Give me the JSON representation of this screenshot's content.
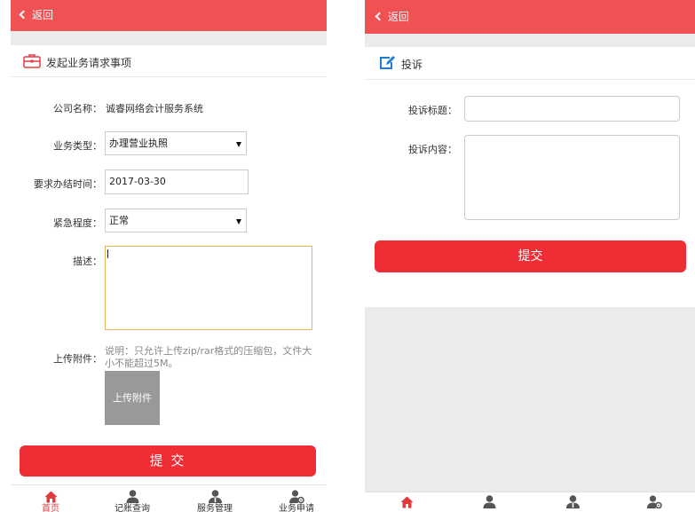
{
  "colors": {
    "brand": "#f05153",
    "submit": "#ee2e34",
    "active_tab": "#e03a3c",
    "focus_border": "#e6b75a",
    "edit_icon": "#1e7bd6"
  },
  "left": {
    "back_label": "返回",
    "section_title": "发起业务请求事项",
    "fields": {
      "company_label": "公司名称：",
      "company_value": "诚睿网络会计服务系统",
      "type_label": "业务类型：",
      "type_value": "办理营业执照",
      "deadline_label": "要求办结时间：",
      "deadline_value": "2017-03-30",
      "urgency_label": "紧急程度：",
      "urgency_value": "正常",
      "desc_label": "描述：",
      "desc_value": "",
      "attach_label": "上传附件：",
      "attach_note": "说明：只允许上传zip/rar格式的压缩包，文件大小不能超过5M。",
      "upload_button": "上传附件"
    },
    "submit_label": "提 交",
    "tabs": [
      {
        "label": "首页",
        "icon": "home-icon",
        "active": true
      },
      {
        "label": "记账查询",
        "icon": "user-icon",
        "active": false
      },
      {
        "label": "服务管理",
        "icon": "user-group-icon",
        "active": false
      },
      {
        "label": "业务申请",
        "icon": "user-gear-icon",
        "active": false
      }
    ]
  },
  "right": {
    "back_label": "返回",
    "section_title": "投诉",
    "fields": {
      "title_label": "投诉标题：",
      "title_value": "",
      "content_label": "投诉内容：",
      "content_value": ""
    },
    "submit_label": "提交",
    "tabs": [
      {
        "icon": "home-icon",
        "active": true
      },
      {
        "icon": "user-icon",
        "active": false
      },
      {
        "icon": "user-group-icon",
        "active": false
      },
      {
        "icon": "user-gear-icon",
        "active": false
      }
    ]
  }
}
